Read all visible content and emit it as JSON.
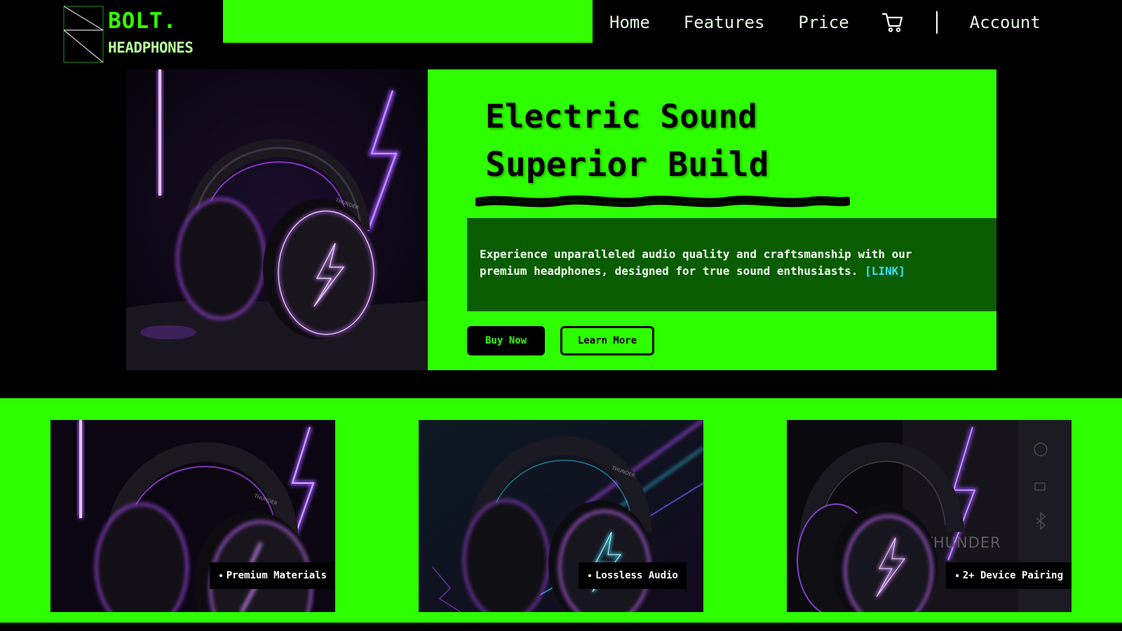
{
  "brand": {
    "name_line1": "BOLT.",
    "name_line2": "HEADPHONES"
  },
  "nav": {
    "items": [
      {
        "label": "Home"
      },
      {
        "label": "Features"
      },
      {
        "label": "Price"
      }
    ],
    "cart_icon": "shopping-cart-icon",
    "account_label": "Account"
  },
  "hero": {
    "title_line1": "Electric Sound",
    "title_line2": "Superior Build",
    "description": "Experience unparalleled audio quality and craftsmanship with our premium headphones, designed for true sound enthusiasts. ",
    "link_text": "[LINK]",
    "buy_label": "Buy Now",
    "learn_label": "Learn More",
    "image_text": "THUNDER"
  },
  "features": [
    {
      "label": "Premium Materials",
      "image_text": "THUNDER"
    },
    {
      "label": "Lossless Audio",
      "image_text": "THUNDER"
    },
    {
      "label": "2+ Device Pairing",
      "image_text": "THUNDER"
    }
  ],
  "colors": {
    "accent_green": "#2eff00",
    "dark_green": "#0a5c00",
    "background": "#000000",
    "neon_purple": "#b04cff",
    "neon_cyan": "#35e0ff"
  }
}
